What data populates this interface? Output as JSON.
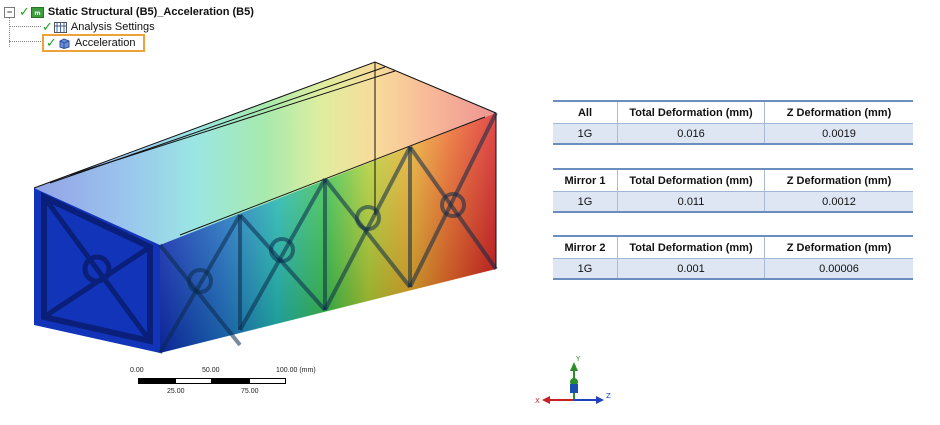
{
  "tree": {
    "root_label": "Static Structural (B5)_Acceleration (B5)",
    "root_icon": "static-structural-icon",
    "children": [
      {
        "label": "Analysis Settings",
        "icon": "analysis-settings-icon"
      },
      {
        "label": "Acceleration",
        "icon": "acceleration-icon"
      }
    ]
  },
  "tables": [
    {
      "headers": [
        "All",
        "Total Deformation (mm)",
        "Z Deformation (mm)"
      ],
      "row": [
        "1G",
        "0.016",
        "0.0019"
      ]
    },
    {
      "headers": [
        "Mirror 1",
        "Total Deformation (mm)",
        "Z Deformation (mm)"
      ],
      "row": [
        "1G",
        "0.011",
        "0.0012"
      ]
    },
    {
      "headers": [
        "Mirror 2",
        "Total Deformation (mm)",
        "Z Deformation (mm)"
      ],
      "row": [
        "1G",
        "0.001",
        "0.00006"
      ]
    }
  ],
  "scale": {
    "top_labels": [
      "0.00",
      "50.00",
      "100.00 (mm)"
    ],
    "bottom_labels": [
      "25.00",
      "75.00"
    ]
  },
  "triad": {
    "x": "X",
    "y": "Y",
    "z": "Z"
  },
  "colors": {
    "accent_highlight": "#f0a23a",
    "check_green": "#23a020",
    "table_row_fill": "#dde6f2",
    "table_rule": "#6c8ebf"
  }
}
